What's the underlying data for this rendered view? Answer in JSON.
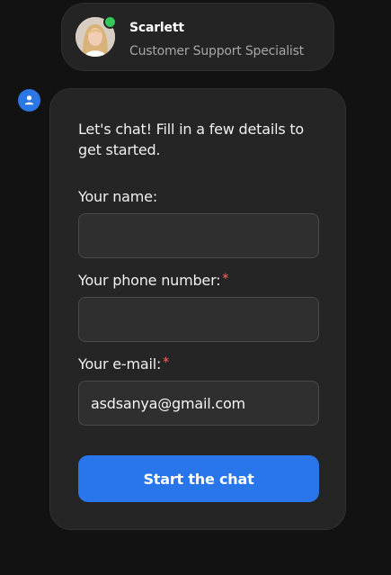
{
  "agent": {
    "name": "Scarlett",
    "role": "Customer Support Specialist",
    "status": "online",
    "status_color": "#34c759"
  },
  "chat": {
    "bot_icon": "user-icon",
    "intro": "Let's chat! Fill in a few details to get started."
  },
  "form": {
    "name": {
      "label": "Your name:",
      "required": false,
      "value": ""
    },
    "phone": {
      "label": "Your phone number:",
      "required": true,
      "value": ""
    },
    "email": {
      "label": "Your e-mail:",
      "required": true,
      "value": "asdsanya@gmail.com"
    },
    "required_mark": "*",
    "submit_label": "Start the chat"
  },
  "colors": {
    "accent": "#2876ea",
    "required": "#ff6b5f"
  }
}
